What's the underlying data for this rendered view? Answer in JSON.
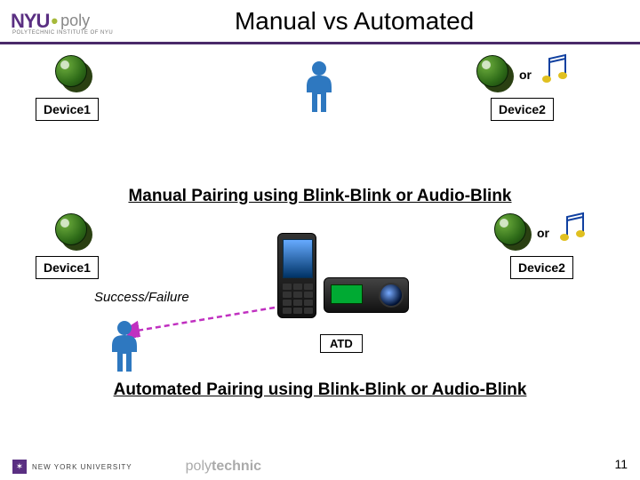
{
  "header": {
    "logo_main": "NYU",
    "logo_sep": "•",
    "logo_side": "poly",
    "logo_sub": "POLYTECHNIC INSTITUTE OF NYU",
    "title": "Manual vs Automated"
  },
  "section1": {
    "device1": "Device1",
    "device2": "Device2",
    "or": "or",
    "caption": "Manual Pairing using Blink-Blink or Audio-Blink"
  },
  "section2": {
    "device1": "Device1",
    "device2": "Device2",
    "or": "or",
    "sf": "Success/Failure",
    "atd": "ATD",
    "caption": "Automated Pairing using Blink-Blink or Audio-Blink"
  },
  "footer": {
    "nyu": "NEW YORK UNIVERSITY",
    "poly1": "poly",
    "poly2": "technic",
    "page": "11"
  }
}
